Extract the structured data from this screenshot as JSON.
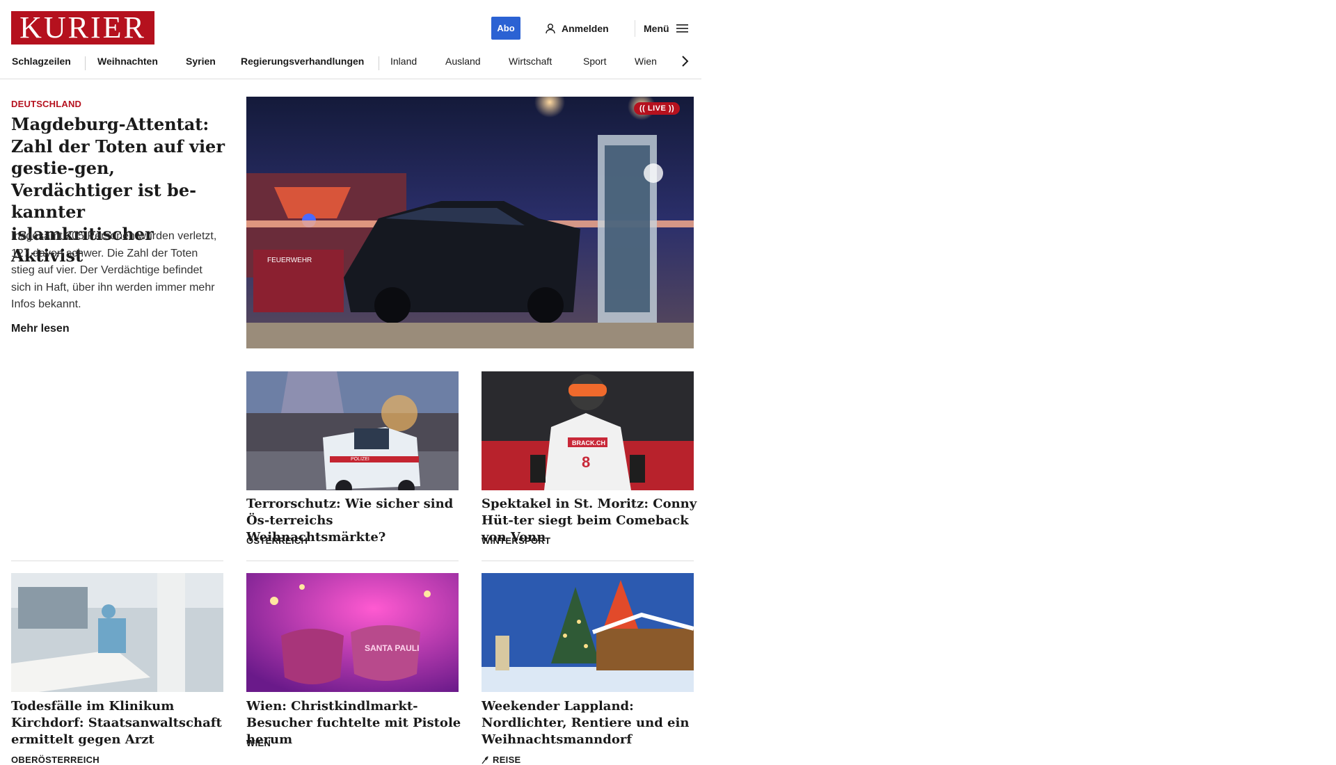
{
  "header": {
    "logo": "KURIER",
    "abo_label": "Abo",
    "login_label": "Anmelden",
    "menu_label": "Menü"
  },
  "nav": {
    "items": [
      {
        "label": "Schlagzeilen"
      },
      {
        "label": "Weihnachten"
      },
      {
        "label": "Syrien"
      },
      {
        "label": "Regierungsverhandlungen"
      },
      {
        "label": "Inland"
      },
      {
        "label": "Ausland"
      },
      {
        "label": "Wirtschaft"
      },
      {
        "label": "Sport"
      },
      {
        "label": "Wien"
      }
    ]
  },
  "lead": {
    "kicker": "DEUTSCHLAND",
    "title": "Magdeburg-Attentat: Zahl der Toten auf vier gestie-gen, Verdächtiger ist be-kannter islamkritischer Aktivist",
    "text": "Insgesamt 205 Personen wurden verletzt, 127 davon schwer. Die Zahl der Toten stieg auf vier. Der Verdächtige befindet sich in Haft, über ihn werden immer mehr Infos bekannt.",
    "more_label": "Mehr lesen",
    "live_label": "(( LIVE ))",
    "image_text": "FEUERWEHR"
  },
  "cards": [
    {
      "title": "Terrorschutz: Wie sicher sind Ös-terreichs Weihnachtsmärkte?",
      "kicker": "ÖSTERREICH",
      "image_text": "POLIZEI"
    },
    {
      "title": "Spektakel in St. Moritz: Conny Hüt-ter siegt beim Comeback von Vonn",
      "kicker": "WINTERSPORT",
      "image_text": "BRACK.CH",
      "bib_number": "8"
    },
    {
      "title": "Todesfälle im Klinikum Kirchdorf: Staatsanwaltschaft ermittelt gegen Arzt",
      "kicker": "OBERÖSTERREICH"
    },
    {
      "title": "Wien: Christkindlmarkt-Besucher fuchtelte mit Pistole herum",
      "kicker": "WIEN",
      "image_text": "SANTA PAULI"
    },
    {
      "title": "Weekender Lappland: Nordlichter, Rentiere und ein Weihnachtsmanndorf",
      "kicker": "REISE"
    }
  ],
  "colors": {
    "brand": "#b5111e",
    "abo": "#2b62d3",
    "divider": "#dedede"
  },
  "icons": {
    "login": "user-icon",
    "menu": "hamburger-icon",
    "nav_more": "chevron-right-icon",
    "reise": "feather-icon"
  }
}
